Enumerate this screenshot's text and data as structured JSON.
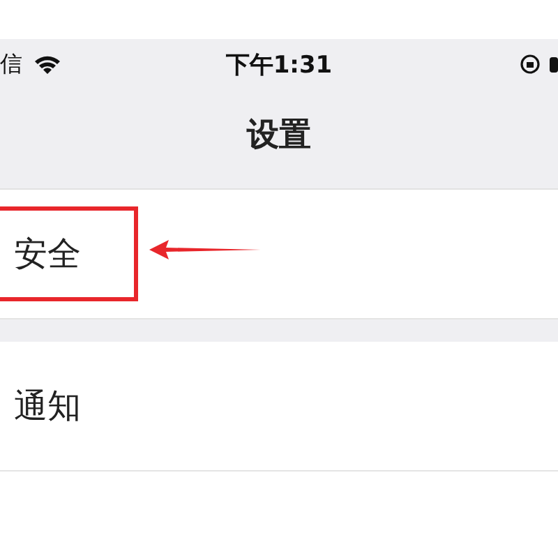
{
  "status_bar": {
    "carrier": "信",
    "time": "下午1:31"
  },
  "nav": {
    "title": "设置"
  },
  "sections": [
    {
      "rows": [
        {
          "label": "安全",
          "highlighted": true
        }
      ]
    },
    {
      "rows": [
        {
          "label": "通知",
          "highlighted": false
        }
      ]
    }
  ]
}
